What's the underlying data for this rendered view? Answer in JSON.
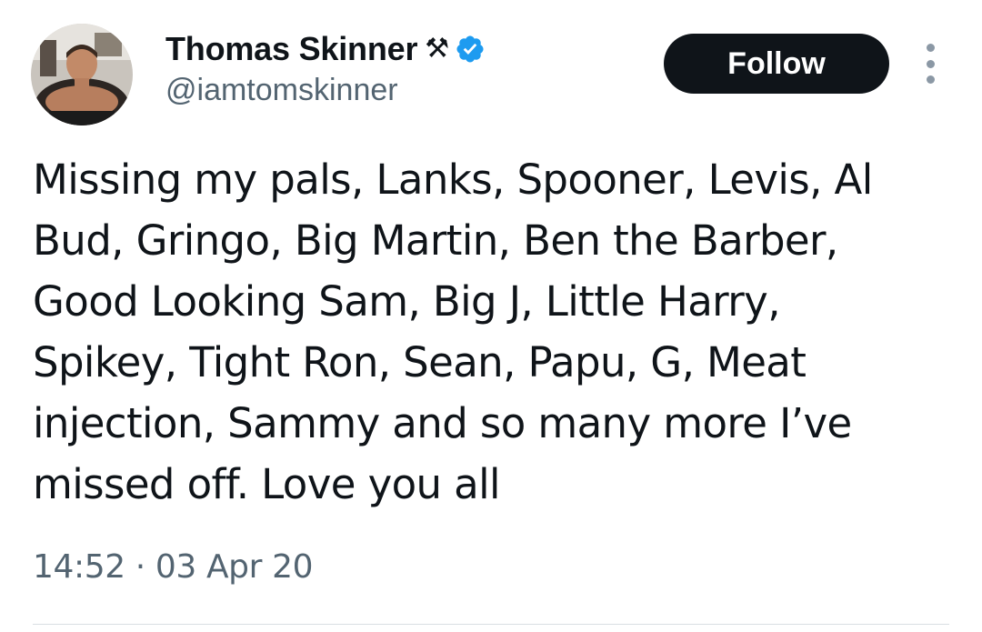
{
  "author": {
    "display_name": "Thomas Skinner",
    "name_emoji": "⚒",
    "verified": true,
    "handle": "@iamtomskinner"
  },
  "actions": {
    "follow_label": "Follow"
  },
  "tweet": {
    "text": "Missing my pals, Lanks, Spooner, Levis, Al\nBud, Gringo, Big Martin, Ben the Barber,\nGood Looking Sam, Big J, Little Harry,\nSpikey, Tight Ron, Sean, Papu, G, Meat\ninjection, Sammy and so many more I’ve\nmissed off. Love you all",
    "time": "14:52",
    "separator": " · ",
    "date": "03 Apr 20"
  },
  "colors": {
    "text_primary": "#0f1419",
    "text_secondary": "#536471",
    "verified_blue": "#1d9bf0",
    "follow_bg": "#0f1419"
  }
}
